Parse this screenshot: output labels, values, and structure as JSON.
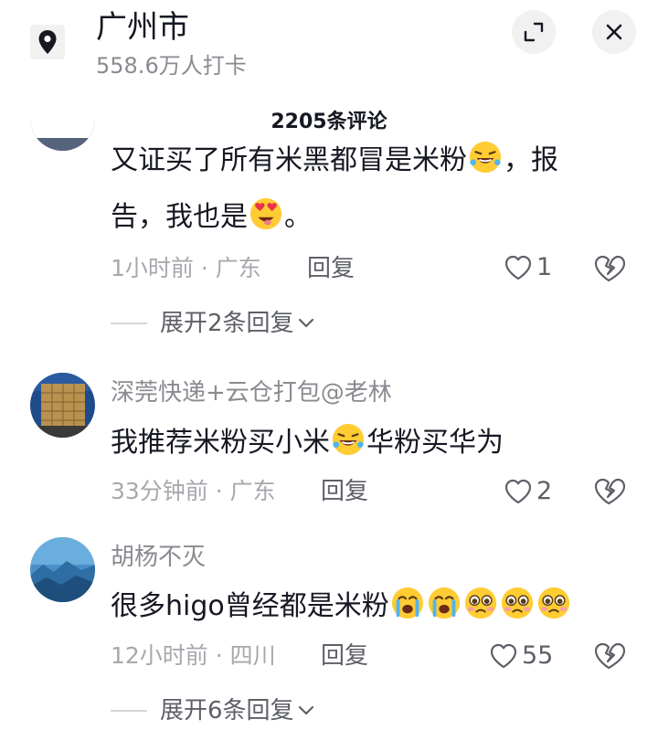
{
  "header": {
    "location_name": "广州市",
    "checkins": "558.6万人打卡",
    "comment_count": "2205条评论"
  },
  "comments": [
    {
      "text_line1": "又证买了所有米黑都冒是米粉",
      "text_line1_end": "，报",
      "text_line2": "告，我也是",
      "text_line2_end": "。",
      "emojis": [
        "rofl-emoji",
        "heart-eyes-emoji"
      ],
      "time": "1小时前 · 广东",
      "reply_label": "回复",
      "likes": "1",
      "expand": "展开2条回复"
    },
    {
      "username": "深莞快递+云仓打包@老林",
      "text_part1": "我推荐米粉买小米",
      "text_part2": "华粉买华为",
      "emojis": [
        "rofl-emoji"
      ],
      "time": "33分钟前 · 广东",
      "reply_label": "回复",
      "likes": "2"
    },
    {
      "username": "胡杨不灭",
      "text": "很多higo曾经都是米粉",
      "emojis": [
        "crying-emoji",
        "crying-emoji",
        "pleading-emoji",
        "pleading-emoji",
        "pleading-emoji"
      ],
      "time": "12小时前 · 四川",
      "reply_label": "回复",
      "likes": "55",
      "expand": "展开6条回复"
    }
  ],
  "colors": {
    "primary_text": "#161823",
    "secondary_text": "#8a8b91",
    "meta_text": "#a7a8ad",
    "button_bg": "#f1f1f2",
    "emoji_yellow": "#ffcc33"
  }
}
